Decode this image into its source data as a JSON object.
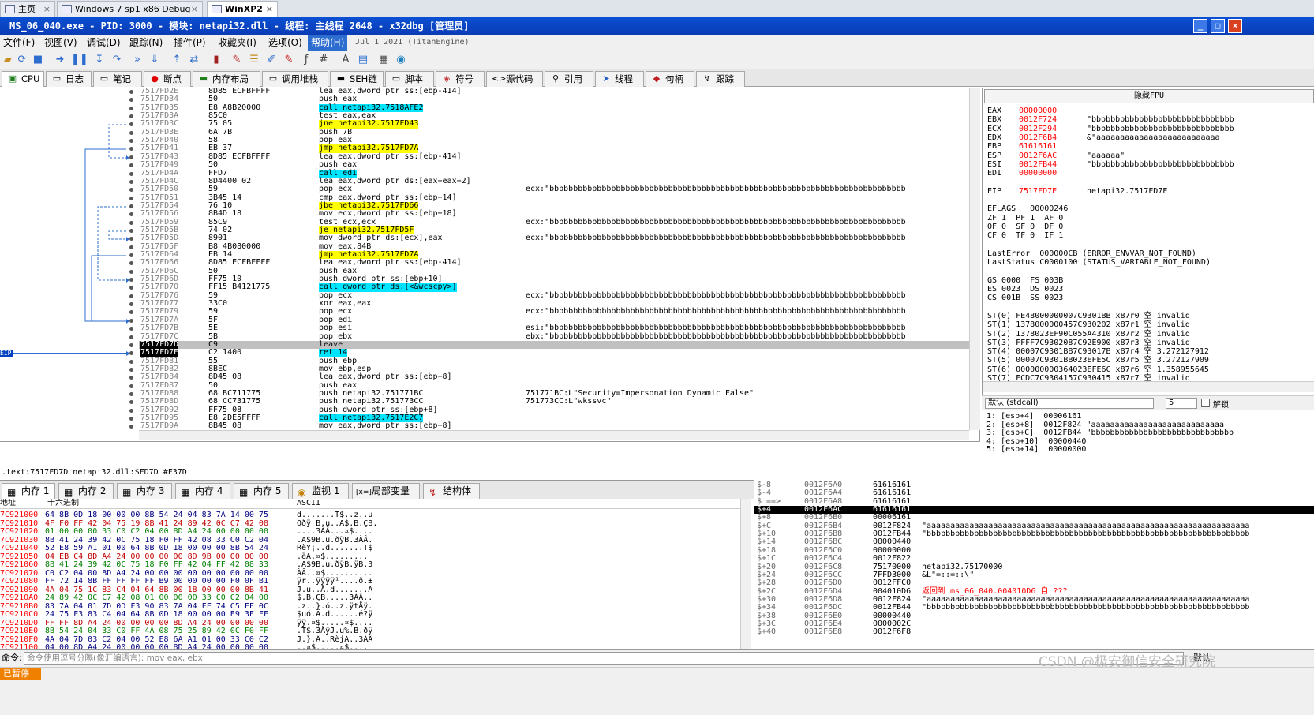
{
  "host_tabs": [
    {
      "label": "主页"
    },
    {
      "label": "Windows 7 sp1 x86 Debug"
    },
    {
      "label": "WinXP2",
      "active": true
    }
  ],
  "title": "MS_06_040.exe - PID: 3000 - 模块: netapi32.dll - 线程: 主线程 2648 - x32dbg [管理员]",
  "menu": {
    "items": [
      "文件(F)",
      "视图(V)",
      "调试(D)",
      "跟踪(N)",
      "插件(P)",
      "收藏夹(I)",
      "选项(O)",
      "帮助(H)"
    ],
    "date": "Jul 1 2021 (TitanEngine)"
  },
  "tabs": [
    "CPU",
    "日志",
    "笔记",
    "断点",
    "内存布局",
    "调用堆栈",
    "SEH链",
    "脚本",
    "符号",
    "源代码",
    "引用",
    "线程",
    "句柄",
    "跟踪"
  ],
  "disasm": [
    {
      "a": "7517FD2E",
      "b": "8D85 ECFBFFFF",
      "i": "lea eax,dword ptr ss:[ebp-414]",
      "c": ""
    },
    {
      "a": "7517FD34",
      "b": "50",
      "i": "push eax",
      "c": ""
    },
    {
      "a": "7517FD35",
      "b": "E8 A8B20000",
      "i": "call netapi32.7518AFE2",
      "k": "call",
      "c": ""
    },
    {
      "a": "7517FD3A",
      "b": "85C0",
      "i": "test eax,eax",
      "c": ""
    },
    {
      "a": "7517FD3C",
      "b": "75 05",
      "i": "jne netapi32.7517FD43",
      "k": "jmp",
      "c": ""
    },
    {
      "a": "7517FD3E",
      "b": "6A 7B",
      "i": "push 7B",
      "c": ""
    },
    {
      "a": "7517FD40",
      "b": "58",
      "i": "pop eax",
      "c": ""
    },
    {
      "a": "7517FD41",
      "b": "EB 37",
      "i": "jmp netapi32.7517FD7A",
      "k": "jmp",
      "c": ""
    },
    {
      "a": "7517FD43",
      "b": "8D85 ECFBFFFF",
      "i": "lea eax,dword ptr ss:[ebp-414]",
      "c": ""
    },
    {
      "a": "7517FD49",
      "b": "50",
      "i": "push eax",
      "c": ""
    },
    {
      "a": "7517FD4A",
      "b": "FFD7",
      "i": "call edi",
      "k": "call",
      "c": ""
    },
    {
      "a": "7517FD4C",
      "b": "8D4400 02",
      "i": "lea eax,dword ptr ds:[eax+eax+2]",
      "c": ""
    },
    {
      "a": "7517FD50",
      "b": "59",
      "i": "pop ecx",
      "c": "ecx:\"bbbbbbbbbbbbbbbbbbbbbbbbbbbbbbbbbbbbbbbbbbbbbbbbbbbbbbbbbbbbbbbbbbbbbbbbbbb"
    },
    {
      "a": "7517FD51",
      "b": "3B45 14",
      "i": "cmp eax,dword ptr ss:[ebp+14]",
      "c": ""
    },
    {
      "a": "7517FD54",
      "b": "76 10",
      "i": "jbe netapi32.7517FD66",
      "k": "jmp",
      "c": ""
    },
    {
      "a": "7517FD56",
      "b": "8B4D 18",
      "i": "mov ecx,dword ptr ss:[ebp+18]",
      "c": ""
    },
    {
      "a": "7517FD59",
      "b": "85C9",
      "i": "test ecx,ecx",
      "c": "ecx:\"bbbbbbbbbbbbbbbbbbbbbbbbbbbbbbbbbbbbbbbbbbbbbbbbbbbbbbbbbbbbbbbbbbbbbbbbbbb"
    },
    {
      "a": "7517FD5B",
      "b": "74 02",
      "i": "je netapi32.7517FD5F",
      "k": "jmp",
      "c": ""
    },
    {
      "a": "7517FD5D",
      "b": "8901",
      "i": "mov dword ptr ds:[ecx],eax",
      "c": "ecx:\"bbbbbbbbbbbbbbbbbbbbbbbbbbbbbbbbbbbbbbbbbbbbbbbbbbbbbbbbbbbbbbbbbbbbbbbbbbb"
    },
    {
      "a": "7517FD5F",
      "b": "B8 4B080000",
      "i": "mov eax,84B",
      "c": ""
    },
    {
      "a": "7517FD64",
      "b": "EB 14",
      "i": "jmp netapi32.7517FD7A",
      "k": "jmp",
      "c": ""
    },
    {
      "a": "7517FD66",
      "b": "8D85 ECFBFFFF",
      "i": "lea eax,dword ptr ss:[ebp-414]",
      "c": ""
    },
    {
      "a": "7517FD6C",
      "b": "50",
      "i": "push eax",
      "c": ""
    },
    {
      "a": "7517FD6D",
      "b": "FF75 10",
      "i": "push dword ptr ss:[ebp+10]",
      "c": ""
    },
    {
      "a": "7517FD70",
      "b": "FF15 B4121775",
      "i": "call dword ptr ds:[<&wcscpy>]",
      "k": "call",
      "c": ""
    },
    {
      "a": "7517FD76",
      "b": "59",
      "i": "pop ecx",
      "c": "ecx:\"bbbbbbbbbbbbbbbbbbbbbbbbbbbbbbbbbbbbbbbbbbbbbbbbbbbbbbbbbbbbbbbbbbbbbbbbbbb"
    },
    {
      "a": "7517FD77",
      "b": "33C0",
      "i": "xor eax,eax",
      "c": ""
    },
    {
      "a": "7517FD79",
      "b": "59",
      "i": "pop ecx",
      "c": "ecx:\"bbbbbbbbbbbbbbbbbbbbbbbbbbbbbbbbbbbbbbbbbbbbbbbbbbbbbbbbbbbbbbbbbbbbbbbbbbb"
    },
    {
      "a": "7517FD7A",
      "b": "5F",
      "i": "pop edi",
      "c": ""
    },
    {
      "a": "7517FD7B",
      "b": "5E",
      "i": "pop esi",
      "c": "esi:\"bbbbbbbbbbbbbbbbbbbbbbbbbbbbbbbbbbbbbbbbbbbbbbbbbbbbbbbbbbbbbbbbbbbbbbbbbbb"
    },
    {
      "a": "7517FD7C",
      "b": "5B",
      "i": "pop ebx",
      "c": "ebx:\"bbbbbbbbbbbbbbbbbbbbbbbbbbbbbbbbbbbbbbbbbbbbbbbbbbbbbbbbbbbbbbbbbbbbbbbbbbb"
    },
    {
      "a": "7517FD7D",
      "b": "C9",
      "i": "leave",
      "c": "",
      "cur": true
    },
    {
      "a": "7517FD7E",
      "b": "C2 1400",
      "i": "ret 14",
      "k": "call",
      "c": "",
      "eip": true
    },
    {
      "a": "7517FD81",
      "b": "55",
      "i": "push ebp",
      "c": ""
    },
    {
      "a": "7517FD82",
      "b": "8BEC",
      "i": "mov ebp,esp",
      "c": ""
    },
    {
      "a": "7517FD84",
      "b": "8D45 08",
      "i": "lea eax,dword ptr ss:[ebp+8]",
      "c": ""
    },
    {
      "a": "7517FD87",
      "b": "50",
      "i": "push eax",
      "c": ""
    },
    {
      "a": "7517FD88",
      "b": "68 BC711775",
      "i": "push netapi32.751771BC",
      "c": "751771BC:L\"Security=Impersonation Dynamic False\""
    },
    {
      "a": "7517FD8D",
      "b": "68 CC731775",
      "i": "push netapi32.751773CC",
      "c": "751773CC:L\"wkssvc\""
    },
    {
      "a": "7517FD92",
      "b": "FF75 08",
      "i": "push dword ptr ss:[ebp+8]",
      "c": ""
    },
    {
      "a": "7517FD95",
      "b": "E8 2DE5FFFF",
      "i": "call netapi32.7517E2C7",
      "k": "call",
      "c": ""
    },
    {
      "a": "7517FD9A",
      "b": "8B45 08",
      "i": "mov eax,dword ptr ss:[ebp+8]",
      "c": ""
    }
  ],
  "info_line": ".text:7517FD7D netapi32.dll:$FD7D #F37D",
  "eip_label": "EIP",
  "regs": {
    "header": "隐藏FPU",
    "gp": [
      {
        "n": "EAX",
        "v": "00000000",
        "c": ""
      },
      {
        "n": "EBX",
        "v": "0012F724",
        "c": "\"bbbbbbbbbbbbbbbbbbbbbbbbbbbbbb"
      },
      {
        "n": "ECX",
        "v": "0012F294",
        "c": "\"bbbbbbbbbbbbbbbbbbbbbbbbbbbbbb"
      },
      {
        "n": "EDX",
        "v": "0012F6B4",
        "c": "&\"aaaaaaaaaaaaaaaaaaaaaaaaaa"
      },
      {
        "n": "EBP",
        "v": "61616161",
        "c": ""
      },
      {
        "n": "ESP",
        "v": "0012F6AC",
        "c": "\"aaaaaa\""
      },
      {
        "n": "ESI",
        "v": "0012FB44",
        "c": "\"bbbbbbbbbbbbbbbbbbbbbbbbbbbbbb"
      },
      {
        "n": "EDI",
        "v": "00000000",
        "c": ""
      }
    ],
    "eip": {
      "n": "EIP",
      "v": "7517FD7E",
      "c": "netapi32.7517FD7E"
    },
    "eflags": "EFLAGS   00000246",
    "flags": [
      "ZF 1  PF 1  AF 0",
      "OF 0  SF 0  DF 0",
      "CF 0  TF 0  IF 1"
    ],
    "lasterr": "LastError  000000CB (ERROR_ENVVAR_NOT_FOUND)",
    "laststat": "LastStatus C0000100 (STATUS_VARIABLE_NOT_FOUND)",
    "segs": [
      "GS 0000  FS 003B",
      "ES 0023  DS 0023",
      "CS 001B  SS 0023"
    ],
    "fpu": [
      "ST(0) FE48000000007C9301BB x87r0 空 invalid",
      "ST(1) 1378000000457C930202 x87r1 空 invalid",
      "ST(2) 1378023EF90C055A4310 x87r2 空 invalid",
      "ST(3) FFFF7C9302087C92E900 x87r3 空 invalid",
      "ST(4) 00007C9301BB7C93017B x87r4 空 3.272127912",
      "ST(5) 00007C9301BB023EFE5C x87r5 空 3.272127909",
      "ST(6) 000000000364023EFE6C x87r6 空 1.358955645",
      "ST(7) FCDC7C9304157C930415 x87r7 空 invalid"
    ]
  },
  "callconv": {
    "label": "默认 (stdcall)",
    "num": "5",
    "unlock": "解锁"
  },
  "stackargs": [
    "1: [esp+4]  00006161",
    "2: [esp+8]  0012F824 \"aaaaaaaaaaaaaaaaaaaaaaaaaaaa",
    "3: [esp+C]  0012FB44 \"bbbbbbbbbbbbbbbbbbbbbbbbbbbbbb",
    "4: [esp+10]  00000440",
    "5: [esp+14]  00000000"
  ],
  "bottom_tabs": [
    "内存 1",
    "内存 2",
    "内存 3",
    "内存 4",
    "内存 5",
    "监视 1",
    "局部变量",
    "结构体"
  ],
  "dump_header": {
    "addr": "地址",
    "hex": "十六进制",
    "ascii": "ASCII"
  },
  "dump": [
    {
      "a": "7C921000",
      "h": "64 8B 0D 18 00 00 00 8B 54 24 04 83 7A 14 00 75",
      "s": "d.......T$..z..u"
    },
    {
      "a": "7C921010",
      "h": "4F F0 FF 42 04 75 19 8B 41 24 89 42 0C C7 42 08",
      "s": "Oðÿ B.u..A$.B.ÇB."
    },
    {
      "a": "7C921020",
      "h": "01 00 00 00 33 C0 C2 04 00 8D A4 24 00 00 00 00",
      "s": "....3ÀÂ...¤$...."
    },
    {
      "a": "7C921030",
      "h": "8B 41 24 39 42 0C 75 18 F0 FF 42 08 33 C0 C2 04",
      "s": ".A$9B.u.ðÿB.3ÀÂ."
    },
    {
      "a": "7C921040",
      "h": "52 E8 59 A1 01 00 64 8B 0D 18 00 00 00 8B 54 24",
      "s": "RèY¡..d.......T$"
    },
    {
      "a": "7C921050",
      "h": "04 EB C4 8D A4 24 00 00 00 00 8D 9B 00 00 00 00",
      "s": ".ëÄ.¤$........."
    },
    {
      "a": "7C921060",
      "h": "8B 41 24 39 42 0C 75 18 F0 FF 42 04 FF 42 08 33",
      "s": ".A$9B.u.ðÿB.ÿB.3"
    },
    {
      "a": "7C921070",
      "h": "C0 C2 04 00 8D A4 24 00 00 00 00 00 00 00 00 00",
      "s": "ÀÂ..¤$.........."
    },
    {
      "a": "7C921080",
      "h": "FF 72 14 8B FF FF FF FF B9 00 00 00 00 F0 0F B1",
      "s": "ÿr..ÿÿÿÿ¹....ð.±"
    },
    {
      "a": "7C921090",
      "h": "4A 04 75 1C 83 C4 04 64 8B 00 18 00 00 00 8B 41",
      "s": "J.u..Ä.d.......A"
    },
    {
      "a": "7C9210A0",
      "h": "24 89 42 0C C7 42 08 01 00 00 00 33 C0 C2 04 00",
      "s": "$.B.ÇB.....3ÀÂ.."
    },
    {
      "a": "7C9210B0",
      "h": "83 7A 04 01 7D 0D F3 90 83 7A 04 FF 74 C5 FF 0C",
      "s": ".z..}.ó..z.ÿtÅÿ."
    },
    {
      "a": "7C9210C0",
      "h": "24 75 F3 83 C4 04 64 8B 0D 18 00 00 00 E9 3F FF",
      "s": "$uó.Ä.d......é?ÿ"
    },
    {
      "a": "7C9210D0",
      "h": "FF FF 8D A4 24 00 00 00 00 8D A4 24 00 00 00 00",
      "s": "ÿÿ.¤$.....¤$...."
    },
    {
      "a": "7C9210E0",
      "h": "8B 54 24 04 33 C0 FF 4A 08 75 25 89 42 0C F0 FF",
      "s": ".T$.3ÀÿJ.u%.B.ðÿ"
    },
    {
      "a": "7C9210F0",
      "h": "4A 04 7D 03 C2 04 00 52 E8 6A A1 01 00 33 C0 C2",
      "s": "J.}.Â..RèjÁ..3ÀÂ"
    },
    {
      "a": "7C921100",
      "h": "04 00 8D A4 24 00 00 00 00 8D A4 24 00 00 00 00",
      "s": "..¤$.....¤$...."
    }
  ],
  "stack": [
    {
      "o": "$-8",
      "a": "0012F6A0",
      "v": "61616161",
      "c": ""
    },
    {
      "o": "$-4",
      "a": "0012F6A4",
      "v": "61616161",
      "c": ""
    },
    {
      "o": "$ ==>",
      "a": "0012F6A8",
      "v": "61616161",
      "c": ""
    },
    {
      "o": "$+4",
      "a": "0012F6AC",
      "v": "61616161",
      "c": "",
      "cur": true
    },
    {
      "o": "$+8",
      "a": "0012F6B0",
      "v": "00006161",
      "c": ""
    },
    {
      "o": "$+C",
      "a": "0012F6B4",
      "v": "0012F824",
      "c": "\"aaaaaaaaaaaaaaaaaaaaaaaaaaaaaaaaaaaaaaaaaaaaaaaaaaaaaaaaaaaaaaaaaaaa"
    },
    {
      "o": "$+10",
      "a": "0012F6B8",
      "v": "0012FB44",
      "c": "\"bbbbbbbbbbbbbbbbbbbbbbbbbbbbbbbbbbbbbbbbbbbbbbbbbbbbbbbbbbbbbbbbbbbb"
    },
    {
      "o": "$+14",
      "a": "0012F6BC",
      "v": "00000440",
      "c": ""
    },
    {
      "o": "$+18",
      "a": "0012F6C0",
      "v": "00000000",
      "c": ""
    },
    {
      "o": "$+1C",
      "a": "0012F6C4",
      "v": "0012F822",
      "c": ""
    },
    {
      "o": "$+20",
      "a": "0012F6C8",
      "v": "75170000",
      "c": "netapi32.75170000"
    },
    {
      "o": "$+24",
      "a": "0012F6CC",
      "v": "7FFD3000",
      "c": "&L\"=::=::\\\""
    },
    {
      "o": "$+28",
      "a": "0012F6D0",
      "v": "0012FFC0",
      "c": ""
    },
    {
      "o": "$+2C",
      "a": "0012F6D4",
      "v": "004010D6",
      "c": "返回到 ms_06_040.004010D6 自 ???",
      "red": true
    },
    {
      "o": "$+30",
      "a": "0012F6D8",
      "v": "0012F824",
      "c": "\"aaaaaaaaaaaaaaaaaaaaaaaaaaaaaaaaaaaaaaaaaaaaaaaaaaaaaaaaaaaaaaaaaaaa"
    },
    {
      "o": "$+34",
      "a": "0012F6DC",
      "v": "0012FB44",
      "c": "\"bbbbbbbbbbbbbbbbbbbbbbbbbbbbbbbbbbbbbbbbbbbbbbbbbbbbbbbbbbbbbbbbbbbb"
    },
    {
      "o": "$+38",
      "a": "0012F6E0",
      "v": "00000440",
      "c": ""
    },
    {
      "o": "$+3C",
      "a": "0012F6E4",
      "v": "0000002C",
      "c": ""
    },
    {
      "o": "$+40",
      "a": "0012F6E8",
      "v": "0012F6F8",
      "c": ""
    }
  ],
  "cmd": {
    "label": "命令:",
    "placeholder": "命令使用逗号分隔(像汇编语言): mov eax, ebx",
    "right": "默认"
  },
  "status": {
    "state": "已暂停"
  },
  "watermark": "CSDN @极安御信安全研究院"
}
